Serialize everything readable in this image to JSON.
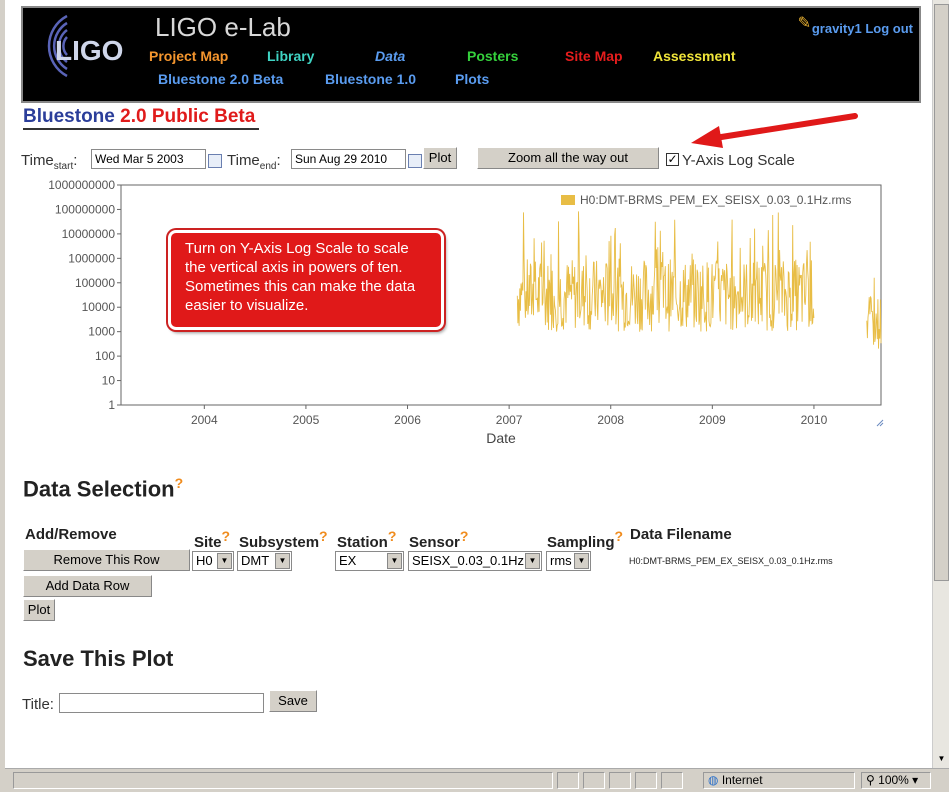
{
  "header": {
    "site_title": "LIGO e-Lab",
    "logo_text": "LIGO",
    "user": "gravity1",
    "logout": "Log out",
    "nav_row1": [
      {
        "label": "Project Map",
        "color": "#f5962e"
      },
      {
        "label": "Library",
        "color": "#3fd3c3"
      },
      {
        "label": "Data",
        "color": "#5a9cf0"
      },
      {
        "label": "Posters",
        "color": "#35d03c"
      },
      {
        "label": "Site Map",
        "color": "#e61d1d"
      },
      {
        "label": "Assessment",
        "color": "#f0e53a"
      }
    ],
    "nav_row2": [
      {
        "label": "Bluestone 2.0 Beta",
        "color": "#5a9cf0"
      },
      {
        "label": "Bluestone 1.0",
        "color": "#5a9cf0"
      },
      {
        "label": "Plots",
        "color": "#5a9cf0"
      }
    ]
  },
  "page_heading": {
    "part1": "Bluestone ",
    "part2": "2.0 Public Beta"
  },
  "controls": {
    "time_label": "Time",
    "start_sub": "start",
    "end_sub": "end",
    "colon": ":",
    "start_value": "Wed Mar 5 2003",
    "end_value": "Sun Aug 29 2010",
    "plot_button": "Plot",
    "zoom_button": "Zoom all the way out",
    "log_scale_label": "Y-Axis Log Scale",
    "log_scale_checked": true
  },
  "callout": {
    "text": "Turn on Y-Axis Log Scale to scale the vertical axis in powers of ten. Sometimes this can make the data easier to visualize."
  },
  "chart_data": {
    "type": "line",
    "xlabel": "Date",
    "ylabel": "",
    "y_scale": "log",
    "ylim": [
      1,
      1000000000
    ],
    "yticks": [
      "1",
      "10",
      "100",
      "1000",
      "10000",
      "100000",
      "1000000",
      "10000000",
      "100000000",
      "1000000000"
    ],
    "xticks": [
      "2004",
      "2005",
      "2006",
      "2007",
      "2008",
      "2009",
      "2010"
    ],
    "xlim": [
      2003.18,
      2010.66
    ],
    "series_color": "#e8bd45",
    "legend": "top-right",
    "series": [
      {
        "name": "H0:DMT-BRMS_PEM_EX_SEISX_0.03_0.1Hz.rms",
        "segments": [
          {
            "x_start": 2007.08,
            "x_end": 2010.0,
            "y_low": 1000,
            "y_high": 1000000,
            "spike_max": 100000000
          },
          {
            "x_start": 2010.52,
            "x_end": 2010.66,
            "y_low": 200,
            "y_high": 30000,
            "spike_max": 200000
          }
        ]
      }
    ],
    "grid": false
  },
  "data_selection": {
    "title": "Data Selection",
    "help": "?",
    "columns": {
      "add_remove": "Add/Remove",
      "site": "Site",
      "subsystem": "Subsystem",
      "station": "Station",
      "sensor": "Sensor",
      "sampling": "Sampling",
      "filename": "Data Filename"
    },
    "row": {
      "site": "H0",
      "subsystem": "DMT",
      "station": "EX",
      "sensor": "SEISX_0.03_0.1Hz",
      "sampling": "rms",
      "filename": "H0:DMT-BRMS_PEM_EX_SEISX_0.03_0.1Hz.rms"
    },
    "remove_button": "Remove This Row",
    "add_button": "Add Data Row",
    "plot_button": "Plot"
  },
  "save_plot": {
    "title": "Save This Plot",
    "title_label": "Title:",
    "title_value": "",
    "save_button": "Save"
  },
  "statusbar": {
    "zone": "Internet",
    "zoom": "100%"
  }
}
